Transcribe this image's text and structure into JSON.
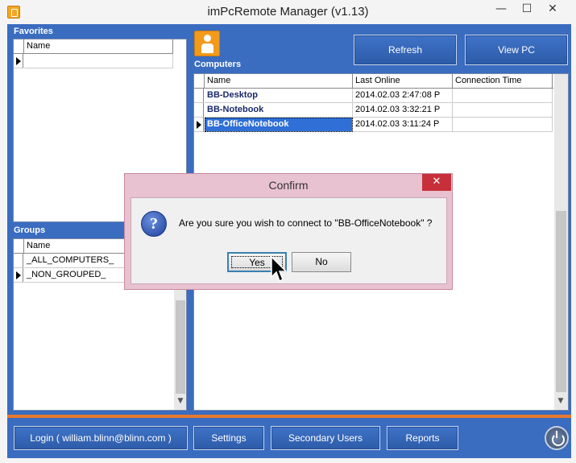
{
  "window": {
    "title": "imPcRemote Manager (v1.13)",
    "minimize_glyph": "—",
    "maximize_glyph": "☐",
    "close_glyph": "✕"
  },
  "favorites": {
    "title": "Favorites",
    "columns": [
      "Name"
    ],
    "rows": [
      ""
    ]
  },
  "groups": {
    "title": "Groups",
    "columns": [
      "Name"
    ],
    "rows": [
      "_ALL_COMPUTERS_",
      "_NON_GROUPED_"
    ]
  },
  "computers": {
    "title": "Computers",
    "columns": [
      "Name",
      "Last Online",
      "Connection Time"
    ],
    "rows": [
      {
        "name": "BB-Desktop",
        "last_online": "2014.02.03 2:47:08 P",
        "connection_time": ""
      },
      {
        "name": "BB-Notebook",
        "last_online": "2014.02.03 3:32:21 P",
        "connection_time": ""
      },
      {
        "name": "BB-OfficeNotebook",
        "last_online": "2014.02.03 3:11:24 P",
        "connection_time": ""
      }
    ]
  },
  "toolbar": {
    "refresh_label": "Refresh",
    "view_pc_label": "View PC"
  },
  "bottom": {
    "login_label": "Login ( william.blinn@blinn.com )",
    "settings_label": "Settings",
    "secondary_users_label": "Secondary Users",
    "reports_label": "Reports"
  },
  "dialog": {
    "title": "Confirm",
    "close_glyph": "✕",
    "icon_glyph": "?",
    "message": "Are you sure you wish to connect to \"BB-OfficeNotebook\" ?",
    "yes_label": "Yes",
    "no_label": "No"
  },
  "colors": {
    "frame_blue": "#3a6cc0",
    "accent_orange": "#e8792e",
    "selection": "#2f6fd6",
    "dialog_close": "#c7303a"
  }
}
